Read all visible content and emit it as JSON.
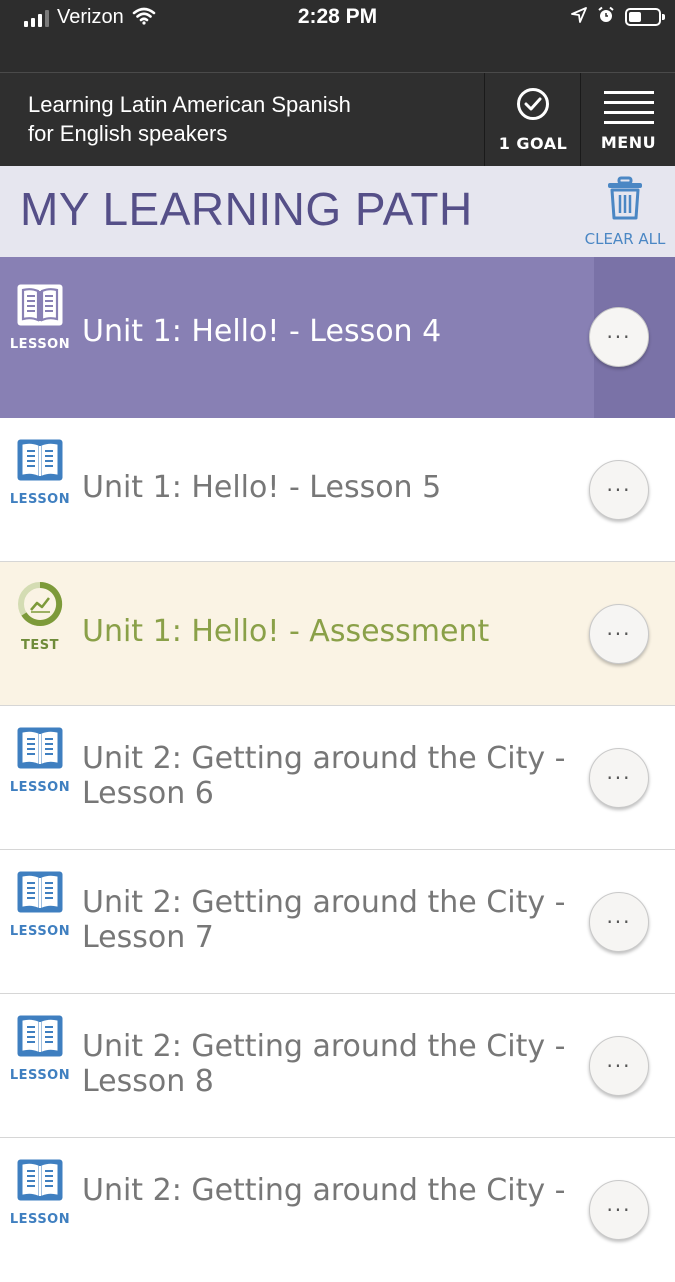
{
  "status_bar": {
    "carrier": "Verizon",
    "time": "2:28 PM",
    "signal_bars_filled": 3,
    "signal_bars_total": 4,
    "battery_level": 0.35
  },
  "app_bar": {
    "title_line1": "Learning Latin American Spanish",
    "title_line2": "for English speakers",
    "goal_label": "1 GOAL",
    "menu_label": "MENU"
  },
  "path_header": {
    "title": "MY LEARNING PATH",
    "clear_all_label": "CLEAR ALL"
  },
  "items": [
    {
      "type_label": "LESSON",
      "line1": "Unit 1: Hello! - Lesson 4",
      "line2": "",
      "state": "active",
      "more": "···"
    },
    {
      "type_label": "LESSON",
      "line1": "Unit 1: Hello! - Lesson 5",
      "line2": "",
      "state": "normal",
      "more": "···"
    },
    {
      "type_label": "TEST",
      "line1": "Unit 1: Hello! - Assessment",
      "line2": "",
      "state": "test",
      "more": "···"
    },
    {
      "type_label": "LESSON",
      "line1": "Unit 2: Getting around the City -",
      "line2": "Lesson 6",
      "state": "normal",
      "more": "···"
    },
    {
      "type_label": "LESSON",
      "line1": "Unit 2: Getting around the City -",
      "line2": "Lesson 7",
      "state": "normal",
      "more": "···"
    },
    {
      "type_label": "LESSON",
      "line1": "Unit 2: Getting around the City -",
      "line2": "Lesson 8",
      "state": "normal",
      "more": "···"
    },
    {
      "type_label": "LESSON",
      "line1": "Unit 2: Getting around the City -",
      "line2": "",
      "state": "normal",
      "more": "···"
    }
  ],
  "colors": {
    "active_row": "#8880b4",
    "test_row": "#faf3e4",
    "lesson_blue": "#3f7fc0",
    "test_green": "#8aa048",
    "path_title": "#554f88"
  }
}
